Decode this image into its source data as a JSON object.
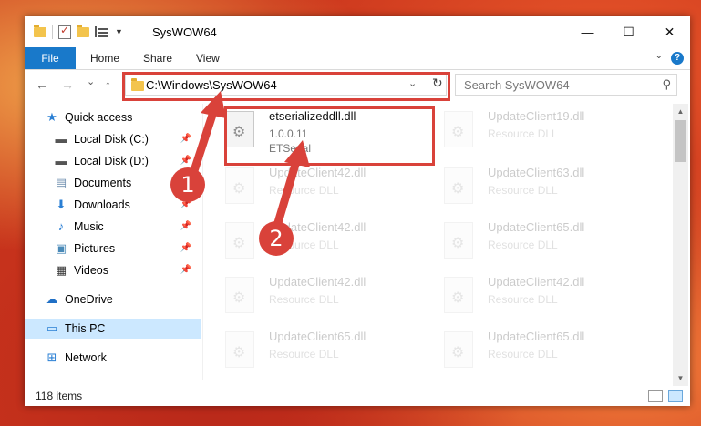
{
  "window": {
    "title": "SysWOW64",
    "minimize_glyph": "—",
    "maximize_glyph": "☐",
    "close_glyph": "✕"
  },
  "ribbon": {
    "tabs": [
      {
        "label": "File"
      },
      {
        "label": "Home"
      },
      {
        "label": "Share"
      },
      {
        "label": "View"
      }
    ],
    "help_glyph": "?"
  },
  "navigation": {
    "back_glyph": "←",
    "forward_glyph": "→",
    "recent_glyph": "⌄",
    "up_glyph": "↑",
    "address": "C:\\Windows\\SysWOW64",
    "address_dropdown_glyph": "⌄",
    "refresh_glyph": "↻",
    "search_placeholder": "Search SysWOW64",
    "search_glyph": "⚲"
  },
  "sidebar": {
    "items": [
      {
        "label": "Quick access",
        "icon": "star-icon"
      },
      {
        "label": "Local Disk (C:)",
        "icon": "drive-icon"
      },
      {
        "label": "Local Disk (D:)",
        "icon": "drive-icon"
      },
      {
        "label": "Documents",
        "icon": "documents-icon"
      },
      {
        "label": "Downloads",
        "icon": "download-icon"
      },
      {
        "label": "Music",
        "icon": "music-icon"
      },
      {
        "label": "Pictures",
        "icon": "pictures-icon"
      },
      {
        "label": "Videos",
        "icon": "videos-icon"
      },
      {
        "label": "OneDrive",
        "icon": "cloud-icon"
      },
      {
        "label": "This PC",
        "icon": "computer-icon"
      },
      {
        "label": "Network",
        "icon": "network-icon"
      }
    ]
  },
  "files": {
    "highlighted": {
      "name": "etserializeddll.dll",
      "version": "1.0.0.11",
      "company": "ETSerial"
    },
    "items": [
      {
        "name": "UpdateClient19.dll",
        "type": "Resource DLL"
      },
      {
        "name": "UpdateClient42.dll",
        "type": "Resource DLL"
      },
      {
        "name": "UpdateClient63.dll",
        "type": "Resource DLL"
      },
      {
        "name": "UpdateClient42.dll",
        "type": "Resource DLL"
      },
      {
        "name": "UpdateClient65.dll",
        "type": "Resource DLL"
      },
      {
        "name": "UpdateClient42.dll",
        "type": "Resource DLL"
      },
      {
        "name": "UpdateClient42.dll",
        "type": "Resource DLL"
      },
      {
        "name": "UpdateClient65.dll",
        "type": "Resource DLL"
      },
      {
        "name": "UpdateClient65.dll",
        "type": "Resource DLL"
      }
    ]
  },
  "status": {
    "item_count": "118 items"
  },
  "annotations": {
    "step1": "1",
    "step2": "2"
  },
  "colors": {
    "accent": "#1979ca",
    "highlight_box": "#d9423a",
    "selected_nav": "#cce8ff"
  }
}
